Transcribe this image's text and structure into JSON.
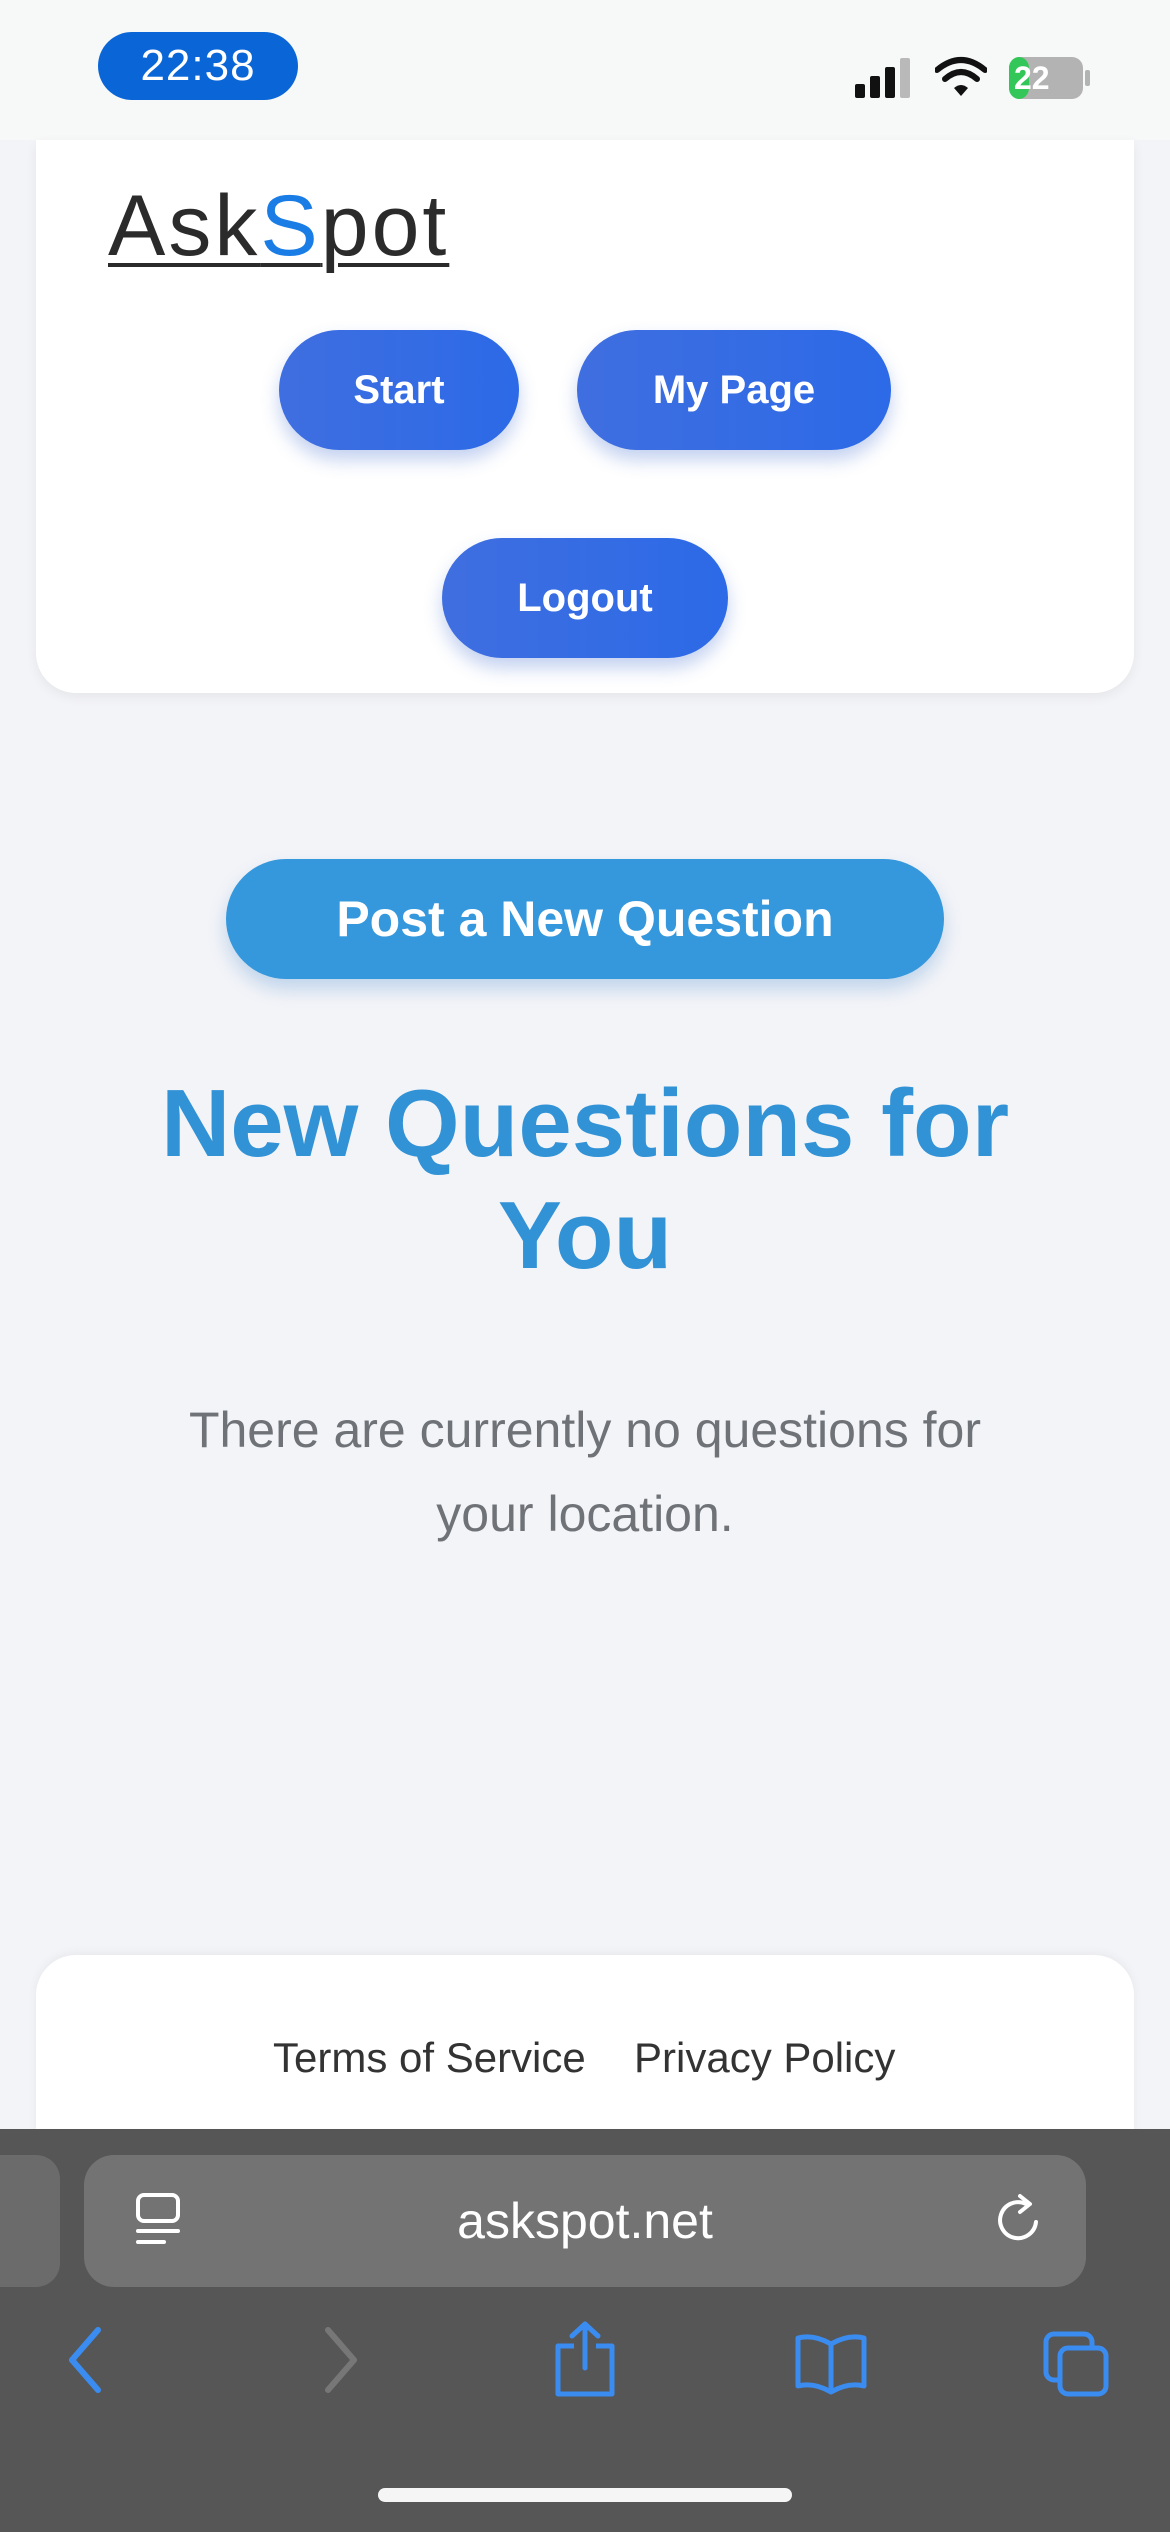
{
  "status_bar": {
    "time": "22:38",
    "battery": "22"
  },
  "header": {
    "logo_prefix": "Ask",
    "logo_highlight": "S",
    "logo_suffix": "pot",
    "nav": {
      "start": "Start",
      "my_page": "My Page",
      "logout": "Logout"
    }
  },
  "main": {
    "post_button": "Post a New Question",
    "title": "New Questions for You",
    "empty_message": "There are currently no questions for your location."
  },
  "footer": {
    "terms": "Terms of Service",
    "privacy": "Privacy Policy"
  },
  "browser": {
    "url": "askspot.net",
    "icons": [
      "page-menu-icon",
      "reload-icon",
      "back-icon",
      "forward-icon",
      "share-icon",
      "bookmarks-icon",
      "tabs-icon"
    ]
  },
  "colors": {
    "accent_blue": "#3598dc",
    "nav_button_blue": "#2c6ae7",
    "logo_s_blue": "#1a7de6",
    "time_pill": "#0a66d6",
    "toolbar_icon_blue": "#3b8cf0"
  }
}
